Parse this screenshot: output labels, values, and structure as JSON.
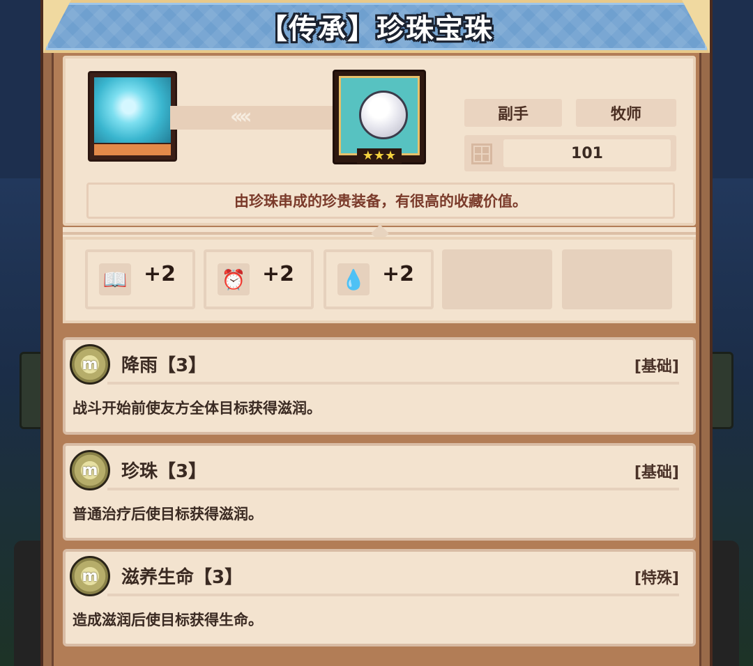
{
  "title": "【传承】珍珠宝珠",
  "item": {
    "slot_tag": "副手",
    "class_tag": "牧师",
    "level": "101",
    "description": "由珍珠串成的珍贵装备，有很高的收藏价值。"
  },
  "stats": [
    {
      "icon": "book-icon",
      "value": "+2"
    },
    {
      "icon": "clock-icon",
      "value": "+2"
    },
    {
      "icon": "water-drop-icon",
      "value": "+2"
    }
  ],
  "skills": [
    {
      "name": "降雨【3】",
      "type": "[基础]",
      "description": "战斗开始前使友方全体目标获得滋润。"
    },
    {
      "name": "珍珠【3】",
      "type": "[基础]",
      "description": "普通治疗后使目标获得滋润。"
    },
    {
      "name": "滋养生命【3】",
      "type": "[特殊]",
      "description": "造成滋润后使目标获得生命。"
    }
  ],
  "colors": {
    "title_bar": "#6fa0cf",
    "panel": "#f3e3cf",
    "frame": "#9a6b4a",
    "description_text": "#7a3a2a"
  }
}
